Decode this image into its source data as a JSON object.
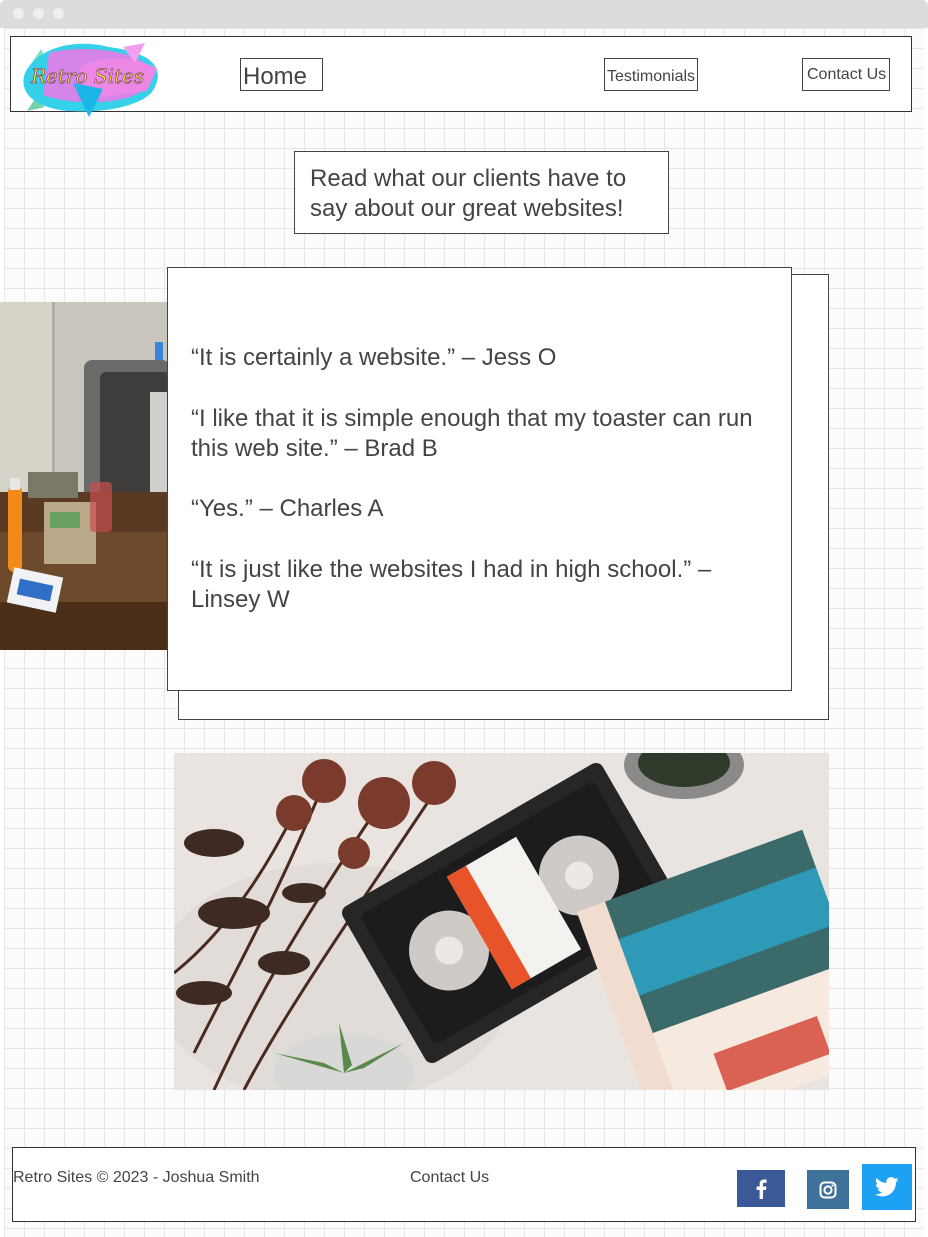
{
  "window": {
    "controls": [
      "close",
      "minimize",
      "maximize"
    ]
  },
  "header": {
    "logo_text": "Retro Sites",
    "nav": {
      "home": "Home",
      "testimonials": "Testimonials",
      "contact": "Contact Us"
    }
  },
  "intro": {
    "text": "Read what our clients have to say about our great websites!"
  },
  "testimonials": [
    {
      "quote": "“It is certainly a website.” – Jess O"
    },
    {
      "quote": "“I like that it is simple enough that my toaster can run this web site.” – Brad B"
    },
    {
      "quote": "“Yes.” – Charles A"
    },
    {
      "quote": "“It is just like the websites I had in high school.” – Linsey W"
    }
  ],
  "images": {
    "side_photo": "retro-tv-desk-photo",
    "main_photo": "vhs-tape-flatlay-photo"
  },
  "footer": {
    "copyright": "Retro Sites © 2023 - Joshua Smith",
    "contact_link": "Contact Us",
    "social": [
      {
        "icon": "facebook-icon",
        "color": "#3b5998"
      },
      {
        "icon": "instagram-icon",
        "color": "#3f729b"
      },
      {
        "icon": "twitter-icon",
        "color": "#1da1f2"
      }
    ]
  },
  "colors": {
    "text": "#444444",
    "border": "#333333",
    "grid": "#e6e6e6"
  }
}
